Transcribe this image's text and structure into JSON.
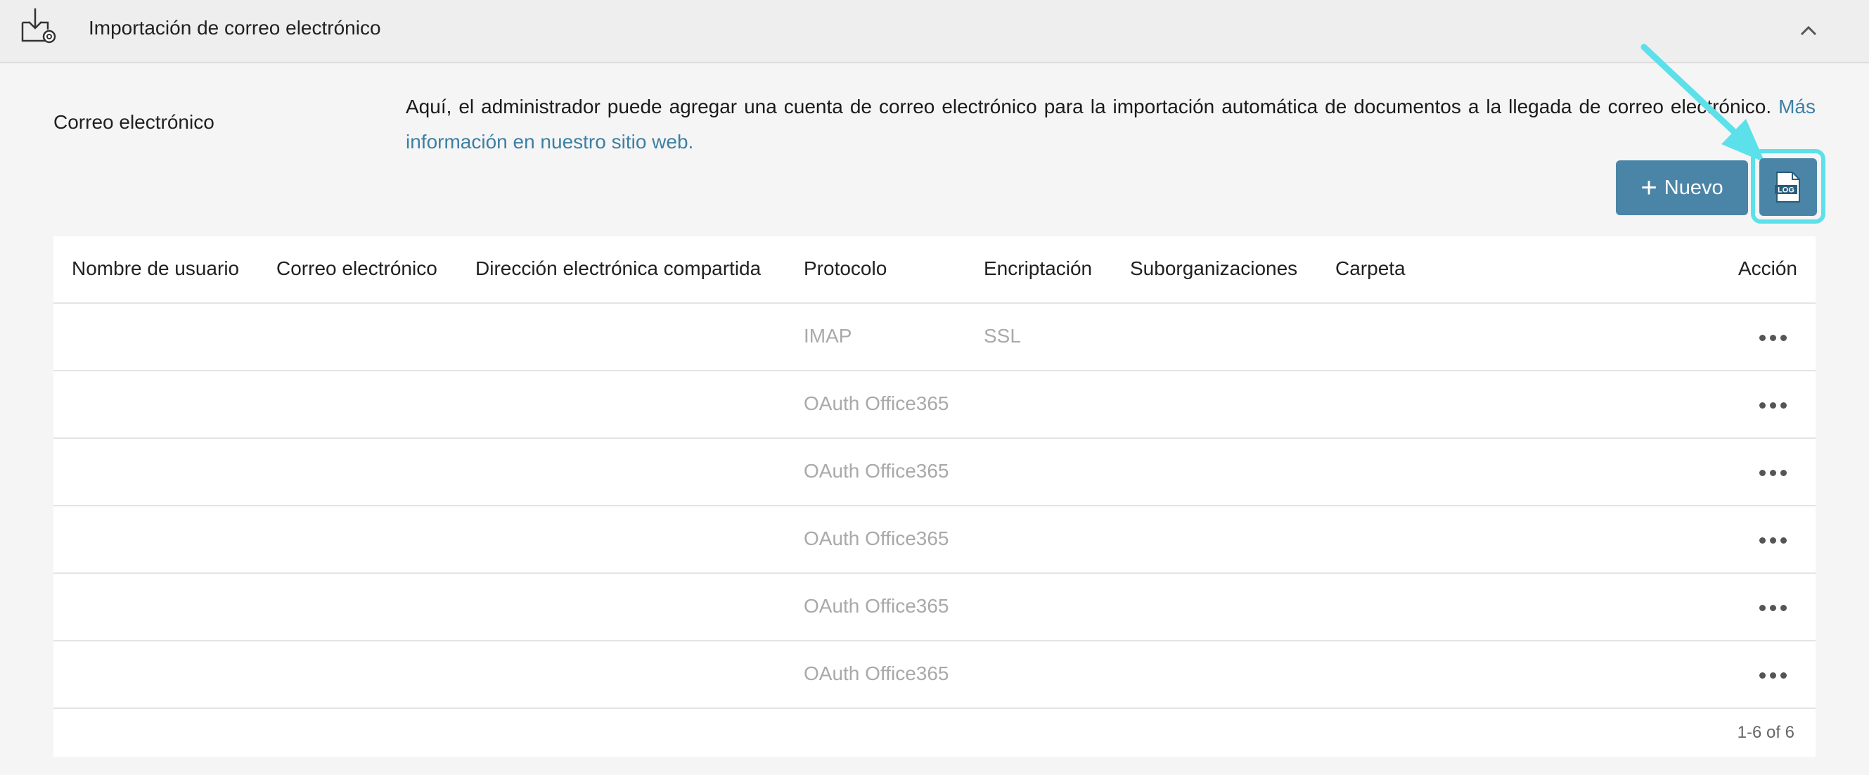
{
  "header": {
    "title": "Importación de correo electrónico",
    "icon": "mail-import-icon",
    "collapse_icon": "chevron-up-icon"
  },
  "section": {
    "label": "Correo electrónico",
    "description": "Aquí, el administrador puede agregar una cuenta de correo electrónico para la importación automática de documentos a la llegada de correo electrónico.",
    "link_text": "Más información en nuestro sitio web."
  },
  "toolbar": {
    "new_label": "Nuevo",
    "log_icon_text": "LOG"
  },
  "table": {
    "columns": [
      "Nombre de usuario",
      "Correo electrónico",
      "Dirección electrónica compartida",
      "Protocolo",
      "Encriptación",
      "Suborganizaciones",
      "Carpeta",
      "Acción"
    ],
    "rows": [
      {
        "username": "",
        "email": "",
        "shared": "",
        "protocol": "IMAP",
        "encryption": "SSL",
        "suborgs": "",
        "folder": ""
      },
      {
        "username": "",
        "email": "",
        "shared": "",
        "protocol": "OAuth Office365",
        "encryption": "",
        "suborgs": "",
        "folder": ""
      },
      {
        "username": "",
        "email": "",
        "shared": "",
        "protocol": "OAuth Office365",
        "encryption": "",
        "suborgs": "",
        "folder": ""
      },
      {
        "username": "",
        "email": "",
        "shared": "",
        "protocol": "OAuth Office365",
        "encryption": "",
        "suborgs": "",
        "folder": ""
      },
      {
        "username": "",
        "email": "",
        "shared": "",
        "protocol": "OAuth Office365",
        "encryption": "",
        "suborgs": "",
        "folder": ""
      },
      {
        "username": "",
        "email": "",
        "shared": "",
        "protocol": "OAuth Office365",
        "encryption": "",
        "suborgs": "",
        "folder": ""
      }
    ],
    "pagination": "1-6 of 6"
  },
  "colors": {
    "accent": "#4a85a8",
    "highlight": "#5ce0ea",
    "link": "#3d7fa3"
  }
}
